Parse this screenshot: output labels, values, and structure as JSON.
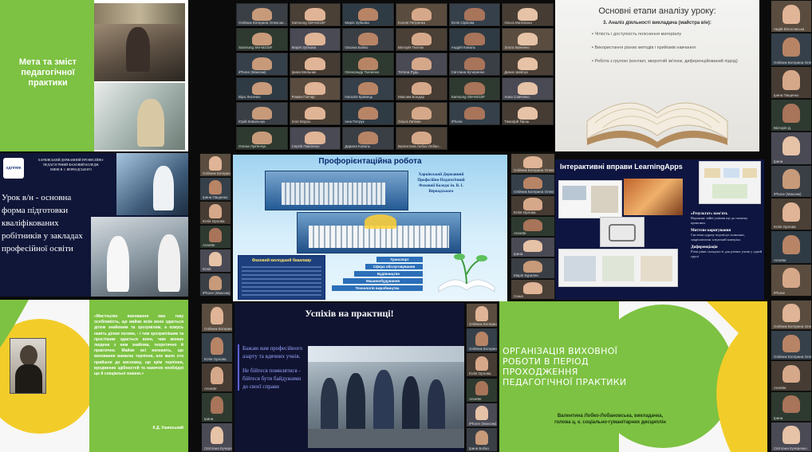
{
  "slide1": {
    "title": "Мета та зміст педагогічної практики",
    "colors": {
      "bg": "#ffffff",
      "accent": "#7dc242"
    }
  },
  "slide2": {
    "header": "Основні етапи аналізу уроку:",
    "subheader": "3. Аналіз діяльності викладача (майстра в/н):",
    "bullets": [
      "Чіткість і доступність пояснення матеріалу",
      "Використання різних методів і прийомів навчання",
      "Робота з групою (контакт, зворотній зв'язок, диференційований підхід)"
    ]
  },
  "slide3": {
    "college_line1": "ХАРКІВСЬКИЙ ДЕРЖАВНИЙ ПРОФЕСІЙНО-",
    "college_line2": "ПЕДАГОГІЧНИЙ ФАХОВИЙ КОЛЕДЖ",
    "college_line3": "ІМЕНІ В. І. ВЕРНАДСЬКОГО",
    "logo_text": "ХДППФК",
    "title": "Урок в/н - основна форма підготовки кваліфікованих робітників у закладах професійної освіти"
  },
  "slide4": {
    "title": "Профорієнтаційна робота",
    "college_name": "Харківський Державний Професійно-Педагогічний Фаховий Коледж ім. В. І. Вернадського",
    "tagline": "Фаховий молодший бакалавр",
    "steps": [
      "Транспорт",
      "Сфера обслуговування",
      "Будівництво",
      "Машинобудування",
      "Технологія виробництва"
    ]
  },
  "slide5": {
    "title": "Інтерактивні вправи LearningApps",
    "items": [
      {
        "heading": "«Результат» пам'ять",
        "text": "Вправляє зайві уміння ще до початку практики."
      },
      {
        "heading": "Миттєве коригування",
        "text": "Система одразу підсвічує помилки, закріплюючи існуючий матеріал."
      },
      {
        "heading": "Диференціація",
        "text": "Різні рівні складності для різних учнів у одній групі"
      }
    ]
  },
  "slide6": {
    "quote": "«Мистецтво виховання має таку особливість, що майже всім воно здається ділом знайомим та зрозумілим, а комусь навіть ділом легким, - і тим зрозумілішим та простішим здається воно, чим менше людина з ним знайома, теоретично й практично. Майже всі визнають, що виховання вимагає терпіння, але мало хто прийшли до висновку, що крім терпіння, вроджених здібностей та навичок необхідні ще й спеціальні знання.»",
    "author": "К.Д. Ушинський"
  },
  "slide7": {
    "title": "Успіхів на практиці!",
    "text1": "Бажаю вам професійного азарту та вдячних учнів.",
    "text2": "Не бійтеся помилятися - бійтеся бути байдужими до своєї справи"
  },
  "slide8": {
    "title": "ОРГАНІЗАЦІЯ ВИХОВНОЇ РОБОТИ В ПЕРІОД ПРОХОДЖЕННЯ ПЕДАГОГІЧНОЇ ПРАКТИКИ",
    "author": "Валентина Лобко-Лобановська, викладачка, голова ц. к. соціально-гуманітарних дисциплін"
  },
  "gallery": {
    "names": [
      "Олійник Катерина Олексан...",
      "Samsung SM-M215F",
      "Марія Зубкова",
      "Ксенія Петренко",
      "Юлія Сірікова",
      "Ольга Матвієнко",
      "Samsung SM-M215F",
      "Марія Зубкова",
      "Оксана Бойко",
      "Вікторія Гнатюк",
      "Андрій Коваль",
      "Злата Іваненко",
      "iPhone (Максим)",
      "Ірина Мельник",
      "Олександр Ткаченко",
      "Тетяна Рудь",
      "Світлана Кучеренко",
      "Денис Шевчук",
      "Віра Лисенко",
      "Роман Гончар",
      "Наталія Кравець",
      "Максим Бондар",
      "Samsung SM-M215F",
      "Анна Савченко",
      "Юрій Ковальчук",
      "Ілля Мороз",
      "Інна Петрук",
      "Ольга Литвин",
      "iPhone",
      "Тимофій Ярош",
      "Олена Лук'янчук",
      "Сергій Павленко",
      "Дарина Коваль",
      "Валентина Лобко-Лобан..."
    ]
  },
  "strips": {
    "right_top": [
      "Авдій Вілосовська",
      "Олійник Катерина Олексан...",
      "Ірина Пащенко",
      "Вікторія Д.",
      "Ірина",
      "iPhone (Максим)",
      "Юлія Орлова",
      "Annette",
      "iPhone"
    ],
    "mid_left": [
      "Олійник Катерина Олексан...",
      "Ірина Пащенко",
      "Юлія Орлова",
      "Annette",
      "Юлія",
      "iPhone (Максим)"
    ],
    "mid_center": [
      "Олійник Катерина Олексан...",
      "Олійник Катерина Олексан...",
      "Юлія Орлова",
      "Annette",
      "Ірина",
      "Марія Курилян",
      "Саша"
    ],
    "mid_right": [
      "Олійник Катерина Олексан...",
      "Олійник Катерина Олексан...",
      "iPhone (Максим)",
      "Annette",
      "Світлана Кучеренко"
    ],
    "bottom_left": [
      "Олійник Катерина Олексан...",
      "Юлія Орлова",
      "Annette",
      "Ірина",
      "Світлана Кучеренко"
    ],
    "bottom_center": [
      "Олійник Катерина Олексан...",
      "Олійник Катерина Олексан...",
      "Юлія Орлова",
      "Annette",
      "iPhone (Максим)",
      "Ірина Бобко"
    ],
    "bottom_right": [
      "Олійник Катерина Олексан...",
      "Олійник Катерина Олексан...",
      "Annette",
      "Ірина",
      "Світлана Кучеренко"
    ]
  }
}
